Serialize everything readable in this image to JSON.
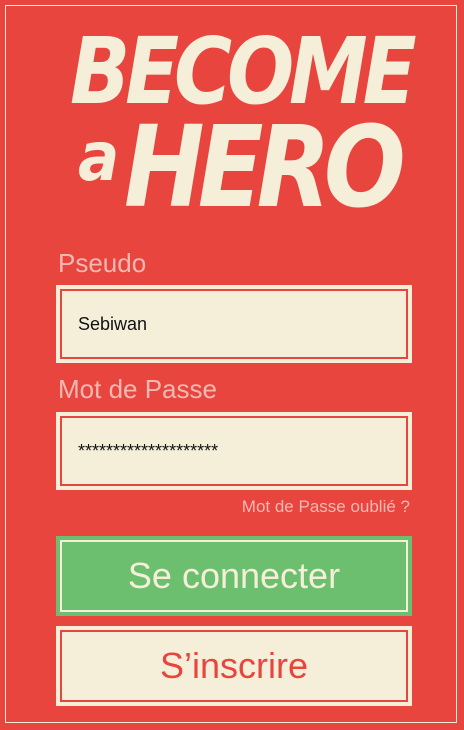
{
  "logo": {
    "line1": "BECOME",
    "line2": "a",
    "line3": "HERO"
  },
  "form": {
    "pseudo_label": "Pseudo",
    "pseudo_value": "Sebiwan",
    "password_label": "Mot de Passe",
    "password_value": "********************",
    "forgot_link": "Mot de Passe oublié ?"
  },
  "buttons": {
    "login": "Se connecter",
    "register": "S’inscrire"
  },
  "colors": {
    "background": "#e8453f",
    "cream": "#f5efd9",
    "green": "#6bbf6e"
  }
}
